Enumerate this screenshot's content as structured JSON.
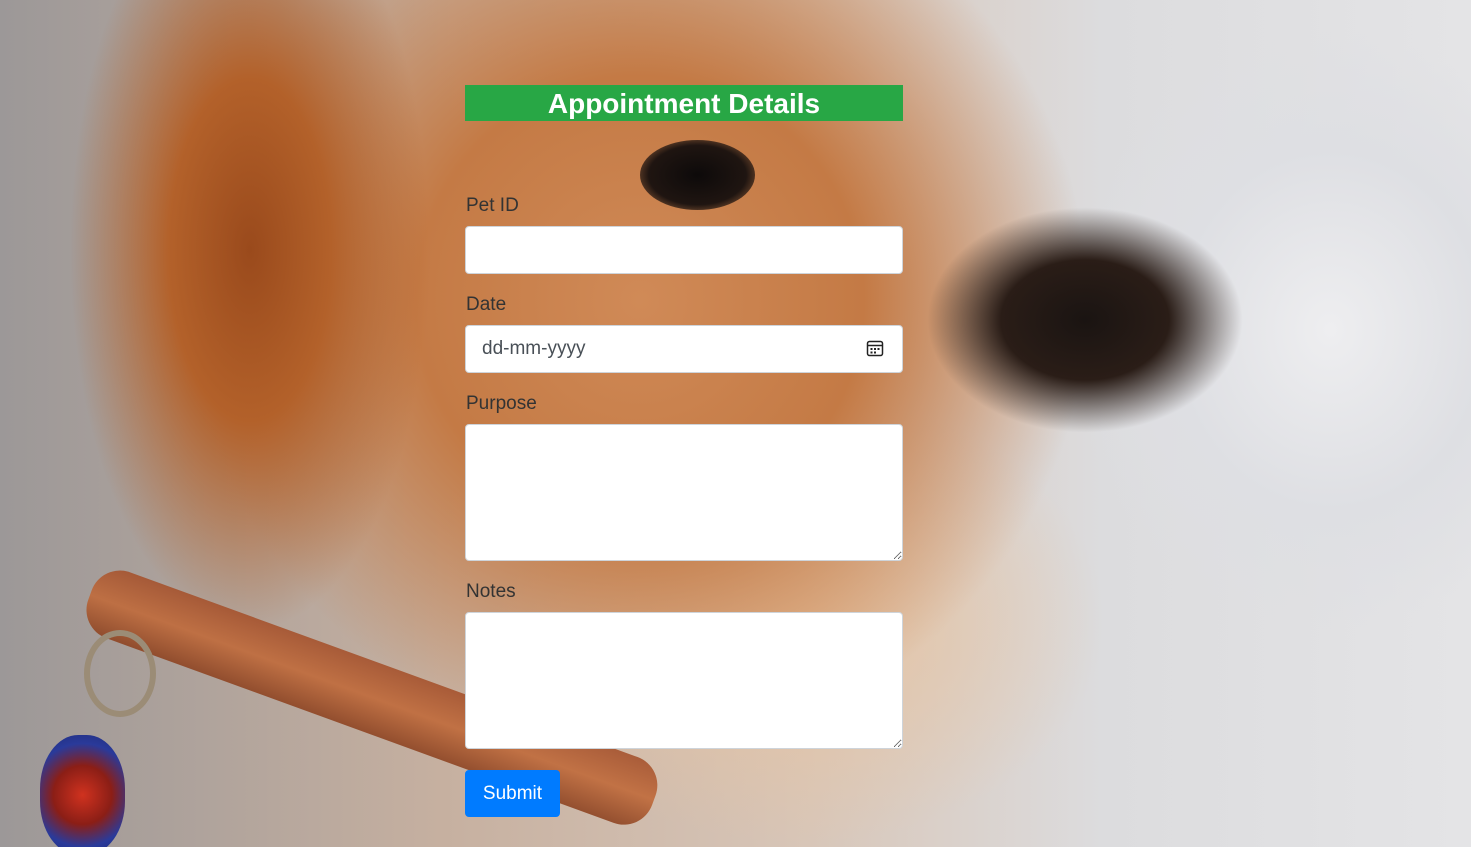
{
  "background": {
    "image": "puppy photo (golden-brown dog with collar)",
    "icon": "dog-photo"
  },
  "form": {
    "title": "Appointment Details",
    "title_bg_color": "#28a745",
    "fields": {
      "pet_id": {
        "label": "Pet ID",
        "value": ""
      },
      "date": {
        "label": "Date",
        "placeholder": "dd-mm-yyyy",
        "icon": "calendar-icon"
      },
      "purpose": {
        "label": "Purpose",
        "value": ""
      },
      "notes": {
        "label": "Notes",
        "value": ""
      }
    },
    "submit_label": "Submit",
    "submit_color": "#007bff"
  }
}
